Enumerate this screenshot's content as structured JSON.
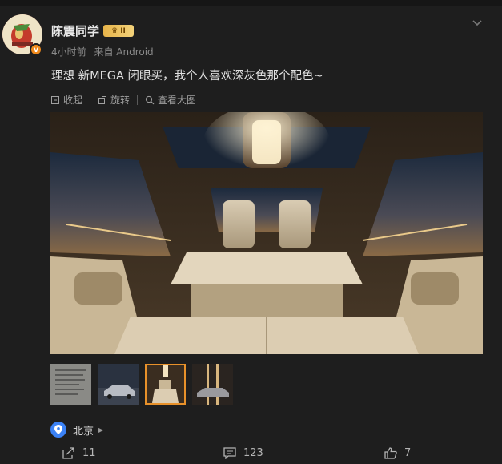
{
  "user": {
    "name": "陈震同学",
    "vip_label": "II",
    "verified_mark": "v",
    "time": "4小时前",
    "source": "来自 Android"
  },
  "post": {
    "text": "理想 新MEGA 闭眼买，我个人喜欢深灰色那个配色~"
  },
  "toolbar": {
    "collapse": "收起",
    "rotate": "旋转",
    "view_large": "查看大图"
  },
  "thumbnails": {
    "count": 4,
    "selected_index": 3
  },
  "location": {
    "name": "北京"
  },
  "actions": {
    "reposts": "11",
    "comments": "123",
    "likes": "7"
  },
  "colors": {
    "accent": "#e8912a",
    "location_pin": "#3b82f6",
    "verified": "#f08a1c"
  }
}
